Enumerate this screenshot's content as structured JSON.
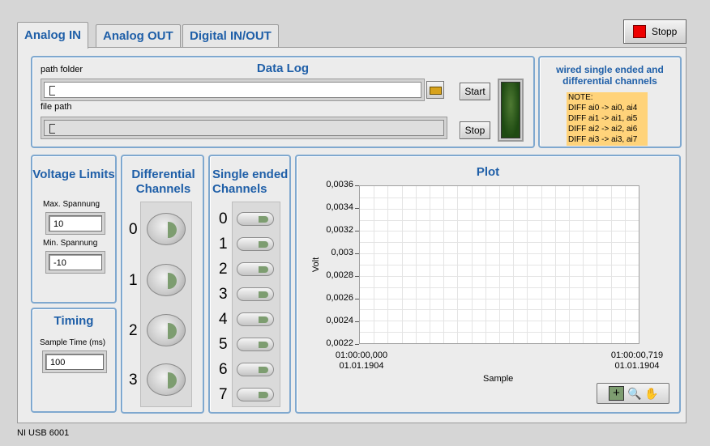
{
  "tabs": [
    {
      "label": "Analog IN",
      "active": true
    },
    {
      "label": "Analog OUT",
      "active": false
    },
    {
      "label": "Digital IN/OUT",
      "active": false
    }
  ],
  "stop_button": {
    "label": "Stopp",
    "indicator_color": "#ee0000"
  },
  "data_log": {
    "title": "Data Log",
    "path_folder_label": "path folder",
    "file_path_label": "file path",
    "start_label": "Start",
    "stop_label": "Stop",
    "led_color": "#1e4a12"
  },
  "wiring_note": {
    "title": "wired single ended and differential channels",
    "lines": [
      "NOTE:",
      "DIFF ai0 -> ai0, ai4",
      "DIFF ai1 -> ai1, ai5",
      "DIFF ai2 -> ai2, ai6",
      "DIFF ai3 -> ai3, ai7"
    ],
    "background": "#ffd37a"
  },
  "voltage_limits": {
    "title": "Voltage Limits",
    "max_label": "Max. Spannung",
    "max_value": "10",
    "min_label": "Min. Spannung",
    "min_value": "-10"
  },
  "timing": {
    "title": "Timing",
    "sample_time_label": "Sample Time (ms)",
    "sample_time_value": "100"
  },
  "differential": {
    "title": "Differential Channels",
    "channels": [
      "0",
      "1",
      "2",
      "3"
    ]
  },
  "single_ended": {
    "title": "Single ended Channels",
    "channels": [
      "0",
      "1",
      "2",
      "3",
      "4",
      "5",
      "6",
      "7"
    ]
  },
  "chart_data": {
    "type": "line",
    "title": "Plot",
    "xlabel": "Sample",
    "ylabel": "Volt",
    "y_ticks": [
      "0,0036",
      "0,0034",
      "0,0032",
      "0,003",
      "0,0028",
      "0,0026",
      "0,0024",
      "0,0022"
    ],
    "ylim": [
      0.0022,
      0.0036
    ],
    "x_start": [
      "01:00:00,000",
      "01.01.1904"
    ],
    "x_end": [
      "01:00:00,719",
      "01.01.1904"
    ],
    "series": [],
    "grid": true
  },
  "status_bar": {
    "device": "NI USB 6001"
  }
}
